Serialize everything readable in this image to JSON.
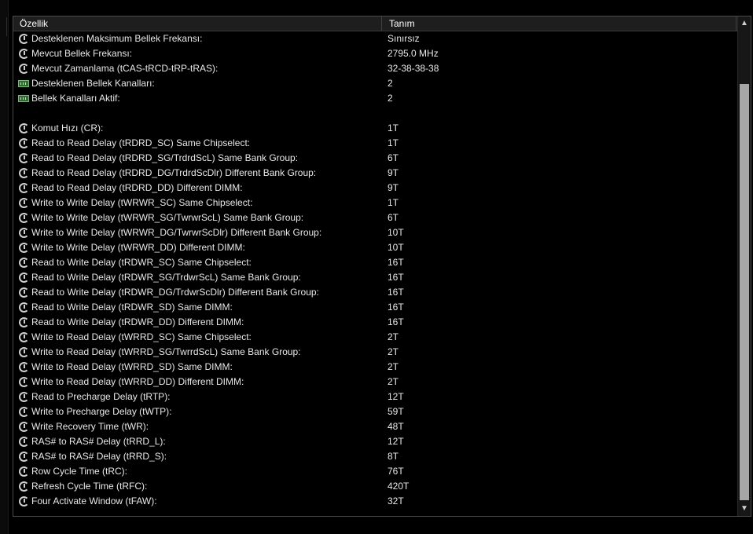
{
  "header": {
    "col_property": "Özellik",
    "col_value": "Tanım"
  },
  "rows": [
    {
      "icon": "clock",
      "name": "Desteklenen Maksimum Bellek Frekansı:",
      "value": "Sınırsız"
    },
    {
      "icon": "clock",
      "name": "Mevcut Bellek Frekansı:",
      "value": "2795.0 MHz"
    },
    {
      "icon": "clock",
      "name": "Mevcut Zamanlama (tCAS-tRCD-tRP-tRAS):",
      "value": "32-38-38-38"
    },
    {
      "icon": "chip",
      "name": "Desteklenen Bellek Kanalları:",
      "value": "2"
    },
    {
      "icon": "chip",
      "name": "Bellek Kanalları Aktif:",
      "value": "2"
    },
    {
      "icon": "none",
      "name": "",
      "value": ""
    },
    {
      "icon": "clock",
      "name": "Komut Hızı (CR):",
      "value": "1T"
    },
    {
      "icon": "clock",
      "name": "Read to Read Delay (tRDRD_SC) Same Chipselect:",
      "value": "1T"
    },
    {
      "icon": "clock",
      "name": "Read to Read Delay (tRDRD_SG/TrdrdScL) Same Bank Group:",
      "value": "6T"
    },
    {
      "icon": "clock",
      "name": "Read to Read Delay (tRDRD_DG/TrdrdScDlr) Different Bank Group:",
      "value": "9T"
    },
    {
      "icon": "clock",
      "name": "Read to Read Delay (tRDRD_DD) Different DIMM:",
      "value": "9T"
    },
    {
      "icon": "clock",
      "name": "Write to Write Delay (tWRWR_SC) Same Chipselect:",
      "value": "1T"
    },
    {
      "icon": "clock",
      "name": "Write to Write Delay (tWRWR_SG/TwrwrScL) Same Bank Group:",
      "value": "6T"
    },
    {
      "icon": "clock",
      "name": "Write to Write Delay (tWRWR_DG/TwrwrScDlr) Different Bank Group:",
      "value": "10T"
    },
    {
      "icon": "clock",
      "name": "Write to Write Delay (tWRWR_DD) Different DIMM:",
      "value": "10T"
    },
    {
      "icon": "clock",
      "name": "Read to Write Delay (tRDWR_SC) Same Chipselect:",
      "value": "16T"
    },
    {
      "icon": "clock",
      "name": "Read to Write Delay (tRDWR_SG/TrdwrScL) Same Bank Group:",
      "value": "16T"
    },
    {
      "icon": "clock",
      "name": "Read to Write Delay (tRDWR_DG/TrdwrScDlr) Different Bank Group:",
      "value": "16T"
    },
    {
      "icon": "clock",
      "name": "Read to Write Delay (tRDWR_SD) Same DIMM:",
      "value": "16T"
    },
    {
      "icon": "clock",
      "name": "Read to Write Delay (tRDWR_DD) Different DIMM:",
      "value": "16T"
    },
    {
      "icon": "clock",
      "name": "Write to Read Delay (tWRRD_SC) Same Chipselect:",
      "value": "2T"
    },
    {
      "icon": "clock",
      "name": "Write to Read Delay (tWRRD_SG/TwrrdScL) Same Bank Group:",
      "value": "2T"
    },
    {
      "icon": "clock",
      "name": "Write to Read Delay (tWRRD_SD) Same DIMM:",
      "value": "2T"
    },
    {
      "icon": "clock",
      "name": "Write to Read Delay (tWRRD_DD) Different DIMM:",
      "value": "2T"
    },
    {
      "icon": "clock",
      "name": "Read to Precharge Delay (tRTP):",
      "value": "12T"
    },
    {
      "icon": "clock",
      "name": "Write to Precharge Delay (tWTP):",
      "value": "59T"
    },
    {
      "icon": "clock",
      "name": "Write Recovery Time (tWR):",
      "value": "48T"
    },
    {
      "icon": "clock",
      "name": "RAS# to RAS# Delay (tRRD_L):",
      "value": "12T"
    },
    {
      "icon": "clock",
      "name": "RAS# to RAS# Delay (tRRD_S):",
      "value": "8T"
    },
    {
      "icon": "clock",
      "name": "Row Cycle Time (tRC):",
      "value": "76T"
    },
    {
      "icon": "clock",
      "name": "Refresh Cycle Time (tRFC):",
      "value": "420T"
    },
    {
      "icon": "clock",
      "name": "Four Activate Window (tFAW):",
      "value": "32T"
    }
  ]
}
